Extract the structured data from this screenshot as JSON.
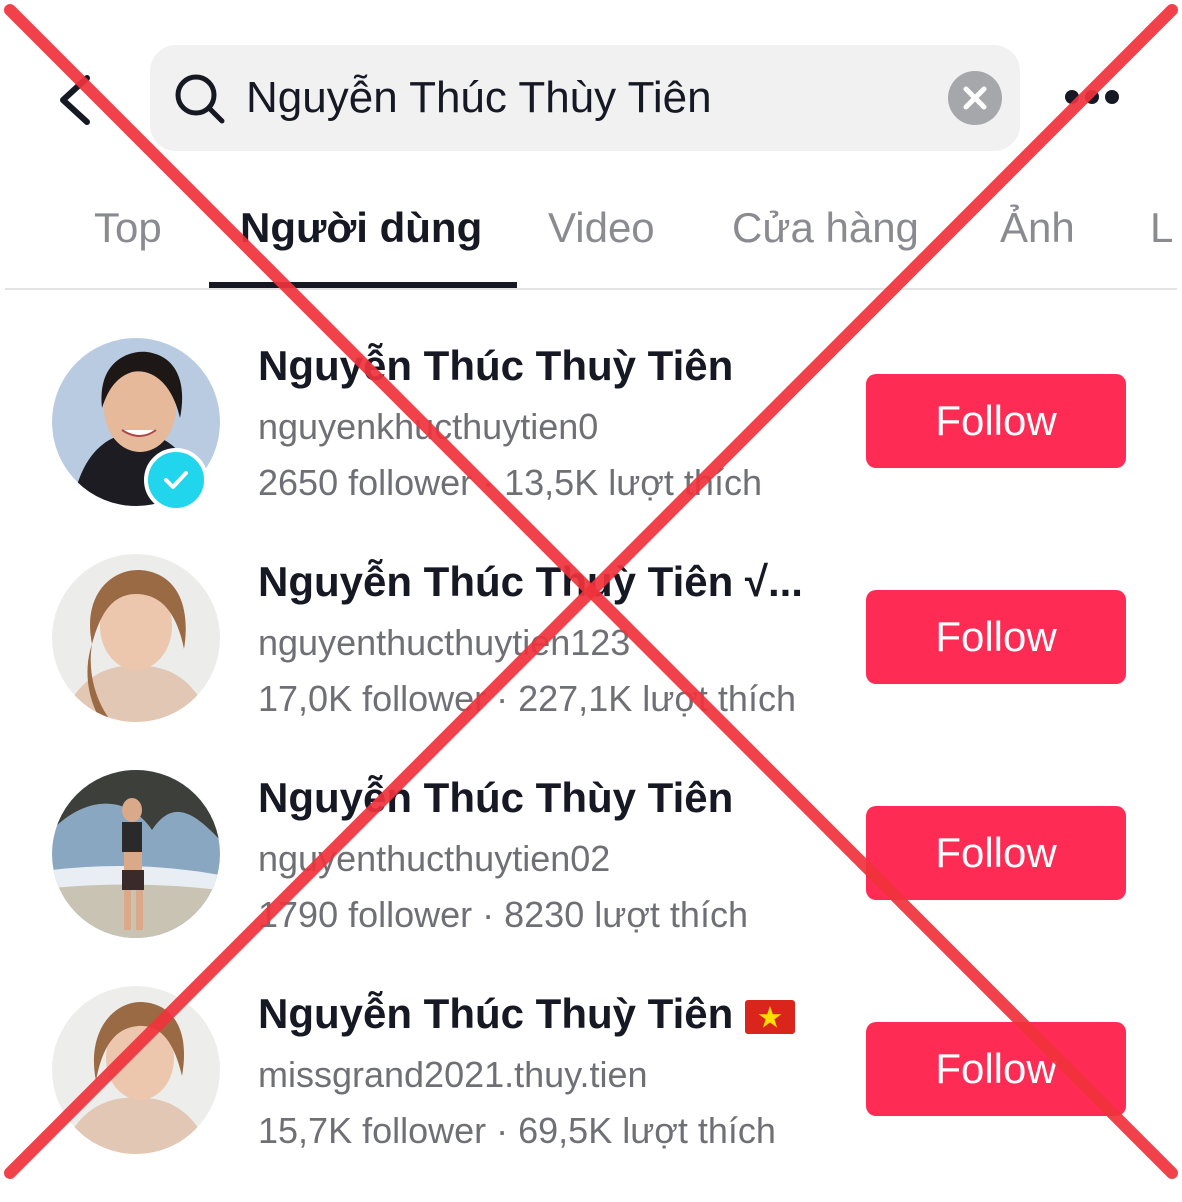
{
  "header": {
    "search": {
      "value": "Nguyễn Thúc Thùy Tiên",
      "icon": "search-icon",
      "clear_icon": "clear-icon"
    },
    "back_icon": "chevron-left-icon",
    "more_icon": "more-icon"
  },
  "tabs": [
    {
      "label": "Top",
      "active": false
    },
    {
      "label": "Người dùng",
      "active": true
    },
    {
      "label": "Video",
      "active": false
    },
    {
      "label": "Cửa hàng",
      "active": false
    },
    {
      "label": "Ảnh",
      "active": false
    },
    {
      "label": "L",
      "active": false
    }
  ],
  "users": [
    {
      "display_name": "Nguyễn Thúc Thuỳ Tiên",
      "handle": "nguyenkhucthuytien0",
      "stats": "2650 follower · 13,5K lượt thích",
      "follow_label": "Follow",
      "verified": true
    },
    {
      "display_name": "Nguyễn Thúc Thuỳ Tiên √...",
      "handle": "nguyenthucthuytien123",
      "stats": "17,0K follower · 227,1K lượt thích",
      "follow_label": "Follow",
      "verified": false
    },
    {
      "display_name": "Nguyễn Thúc Thùy Tiên",
      "handle": "nguyenthucthuytien02",
      "stats": "1790 follower · 8230 lượt thích",
      "follow_label": "Follow",
      "verified": false
    },
    {
      "display_name": "Nguyễn Thúc Thuỳ Tiên",
      "handle": "missgrand2021.thuy.tien",
      "stats": "15,7K follower · 69,5K lượt thích",
      "follow_label": "Follow",
      "verified": false,
      "flag": "vietnam-flag-icon"
    }
  ],
  "colors": {
    "accent": "#fe2c55",
    "verified": "#20d5ec",
    "overlay_cross": "#f0333c"
  }
}
